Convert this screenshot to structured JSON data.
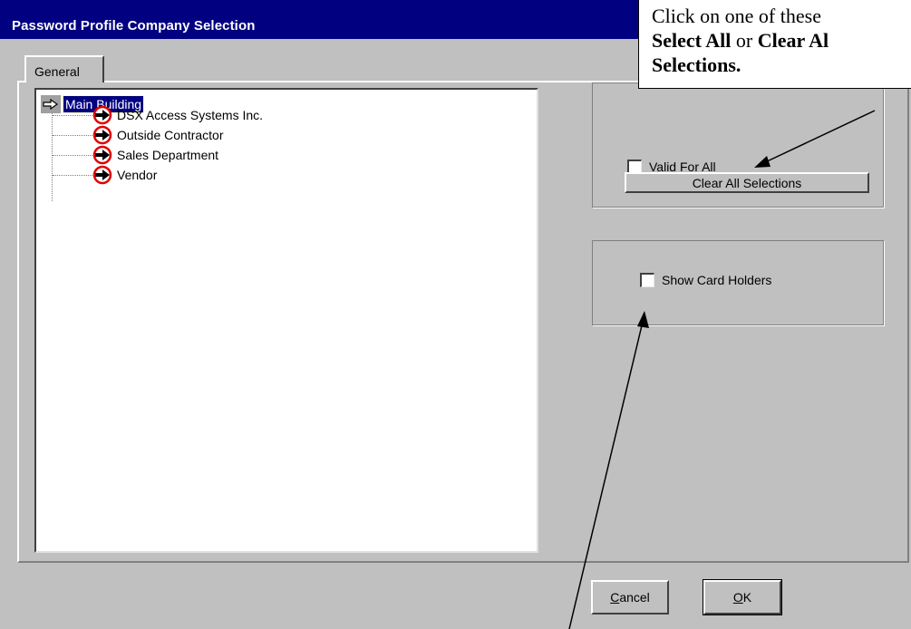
{
  "window": {
    "title": "Password Profile Company Selection"
  },
  "tabs": [
    {
      "label": "General",
      "selected": true
    }
  ],
  "tree": {
    "root": {
      "label": "Main Building",
      "icon": "arrow-right-outline-icon",
      "selected": true
    },
    "items": [
      {
        "label": "DSX Access Systems Inc.",
        "icon": "red-circle-arrow-icon"
      },
      {
        "label": "Outside Contractor",
        "icon": "red-circle-arrow-icon"
      },
      {
        "label": "Sales Department",
        "icon": "red-circle-arrow-icon"
      },
      {
        "label": "Vendor",
        "icon": "red-circle-arrow-icon"
      }
    ]
  },
  "options": {
    "valid_for_all": {
      "label": "Valid For All",
      "checked": false
    },
    "clear_all_label": "Clear All Selections",
    "show_card_holders": {
      "label": "Show Card Holders",
      "checked": false
    }
  },
  "buttons": {
    "cancel": {
      "mnemonic": "C",
      "rest": "ancel"
    },
    "ok": {
      "mnemonic": "O",
      "rest": "K"
    }
  },
  "callout": {
    "line1": "Click on one of these",
    "line2_bold_a": "Select All",
    "line2_mid": " or ",
    "line2_bold_b": "Clear Al",
    "line3_bold": "Selections."
  },
  "colors": {
    "titlebar": "#000080",
    "face": "#c0c0c0",
    "selection": "#000080",
    "icon_red": "#e00000"
  }
}
